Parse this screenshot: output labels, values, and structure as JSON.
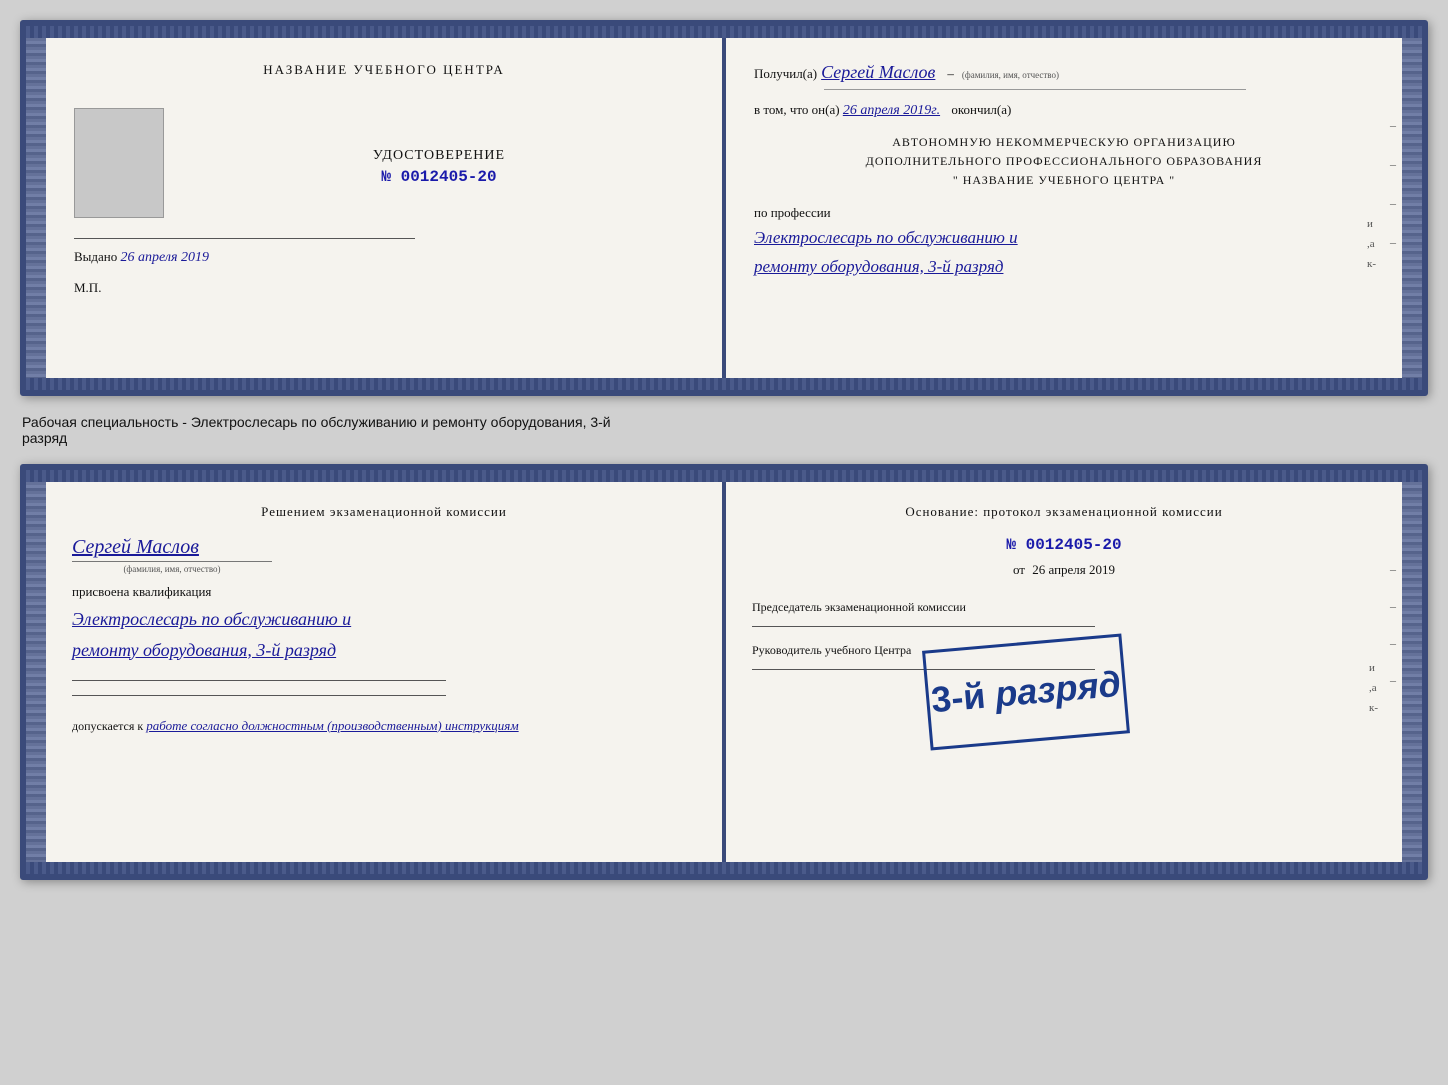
{
  "card1": {
    "left": {
      "org_title": "НАЗВАНИЕ УЧЕБНОГО ЦЕНТРА",
      "udostoverenie": "УДОСТОВЕРЕНИЕ",
      "number": "№ 0012405-20",
      "vydano_label": "Выдано",
      "vydano_date": "26 апреля 2019",
      "mp": "М.П."
    },
    "right": {
      "poluchil_label": "Получил(а)",
      "recipient_name": "Сергей Маслов",
      "fio_hint": "(фамилия, имя, отчество)",
      "dash": "–",
      "vtom_label": "в том, что он(а)",
      "vtom_date": "26 апреля 2019г.",
      "okonchil": "окончил(а)",
      "org_block_line1": "АВТОНОМНУЮ НЕКОММЕРЧЕСКУЮ ОРГАНИЗАЦИЮ",
      "org_block_line2": "ДОПОЛНИТЕЛЬНОГО ПРОФЕССИОНАЛЬНОГО ОБРАЗОВАНИЯ",
      "org_block_line3": "\"   НАЗВАНИЕ УЧЕБНОГО ЦЕНТРА   \"",
      "po_professii": "по профессии",
      "profession_line1": "Электрослесарь по обслуживанию и",
      "profession_line2": "ремонту оборудования, 3-й разряд"
    }
  },
  "between_text": "Рабочая специальность - Электрослесарь по обслуживанию и ремонту оборудования, 3-й",
  "between_text2": "разряд",
  "card2": {
    "left": {
      "resheniem_title": "Решением экзаменационной комиссии",
      "fio_name": "Сергей Маслов",
      "fio_hint": "(фамилия, имя, отчество)",
      "prisvoena": "присвоена квалификация",
      "kvalif_line1": "Электрослесарь по обслуживанию и",
      "kvalif_line2": "ремонту оборудования, 3-й разряд",
      "dopusk_label": "допускается к",
      "dopusk_value": "работе согласно должностным (производственным) инструкциям"
    },
    "right": {
      "osnovanie_title": "Основание: протокол экзаменационной комиссии",
      "number": "№  0012405-20",
      "ot_label": "от",
      "ot_date": "26 апреля 2019",
      "predsedatel_label": "Председатель экзаменационной комиссии",
      "rukovoditel_label": "Руководитель учебного Центра"
    },
    "stamp": {
      "line1": "3-й разряд"
    }
  },
  "icons": {
    "dash": "–"
  }
}
